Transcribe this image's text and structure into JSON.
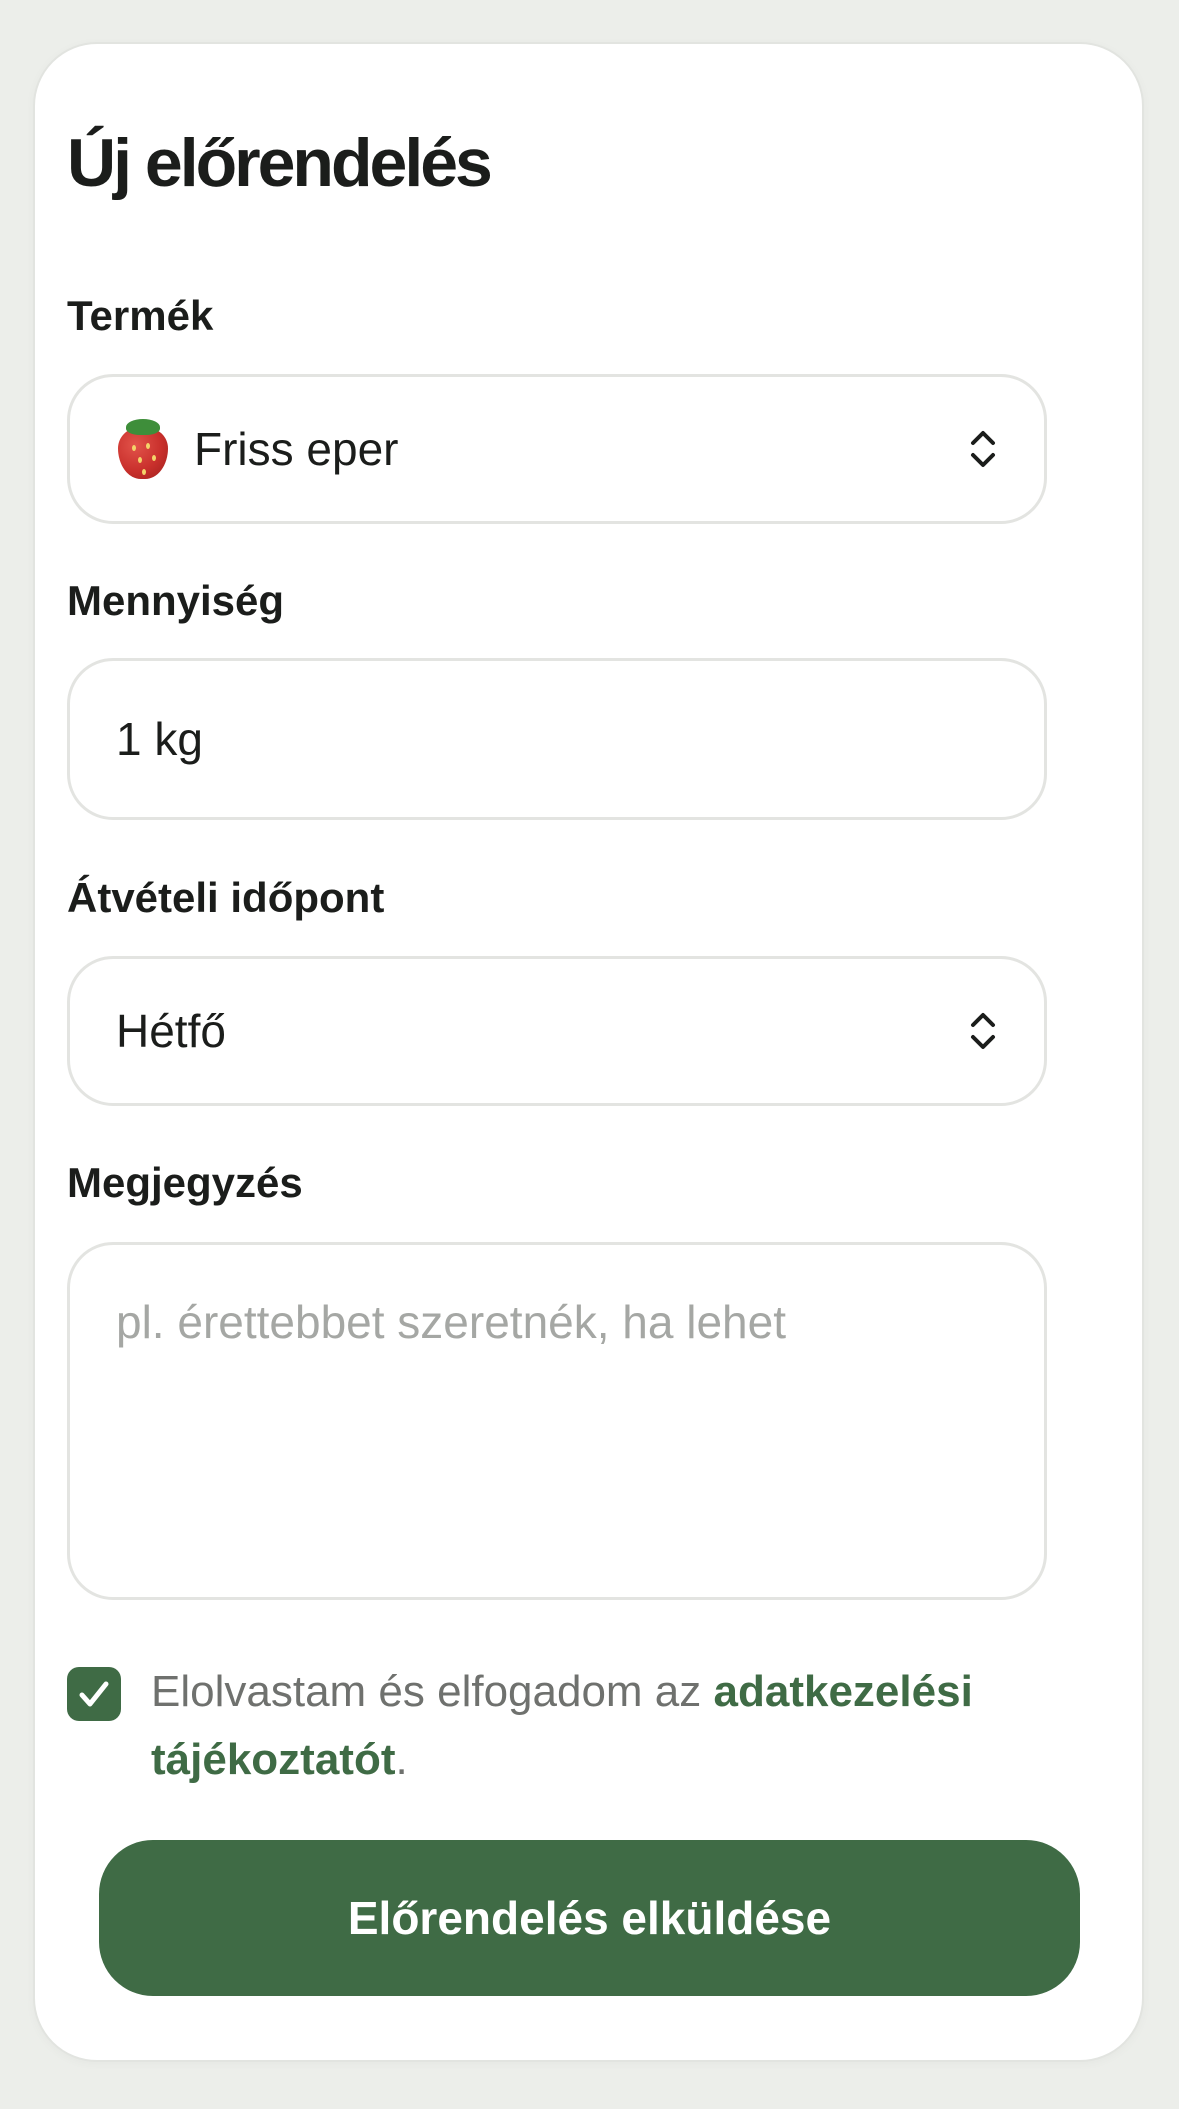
{
  "form": {
    "title": "Új előrendelés",
    "product": {
      "label": "Termék",
      "selected": "Friss eper",
      "icon": "strawberry-icon"
    },
    "quantity": {
      "label": "Mennyiség",
      "value": "1 kg"
    },
    "pickup": {
      "label": "Átvételi időpont",
      "selected": "Hétfő"
    },
    "note": {
      "label": "Megjegyzés",
      "placeholder": "pl. érettebbet szeretnék, ha lehet"
    },
    "consent": {
      "checked": true,
      "text_before": "Elolvastam és elfogadom az ",
      "link_text": "adatkezelési tájékoztatót",
      "text_after": "."
    },
    "submit_label": "Előrendelés elküldése"
  },
  "colors": {
    "accent": "#3f6b45",
    "background": "#eceeea",
    "card": "#ffffff",
    "border": "#e3e4e1",
    "placeholder": "#a5a7a4"
  }
}
